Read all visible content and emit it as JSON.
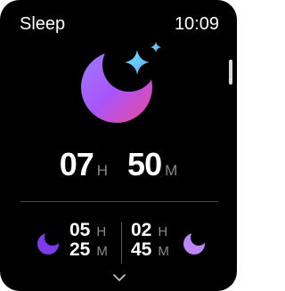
{
  "header": {
    "title": "Sleep",
    "time": "10:09"
  },
  "duration": {
    "hours": "07",
    "hours_unit": "H",
    "minutes": "50",
    "minutes_unit": "M"
  },
  "stages": {
    "deep": {
      "hours": "05",
      "hours_unit": "H",
      "minutes": "25",
      "minutes_unit": "M",
      "icon": "moon-icon",
      "color": "#7c3aed"
    },
    "light": {
      "hours": "02",
      "hours_unit": "H",
      "minutes": "45",
      "minutes_unit": "M",
      "icon": "moon-icon",
      "color": "#c084fc"
    }
  },
  "icons": {
    "hero": "moon-stars-icon",
    "more": "chevron-down-icon"
  },
  "colors": {
    "background": "#000000",
    "accent_purple": "#a855f7",
    "accent_blue": "#60a5fa"
  }
}
